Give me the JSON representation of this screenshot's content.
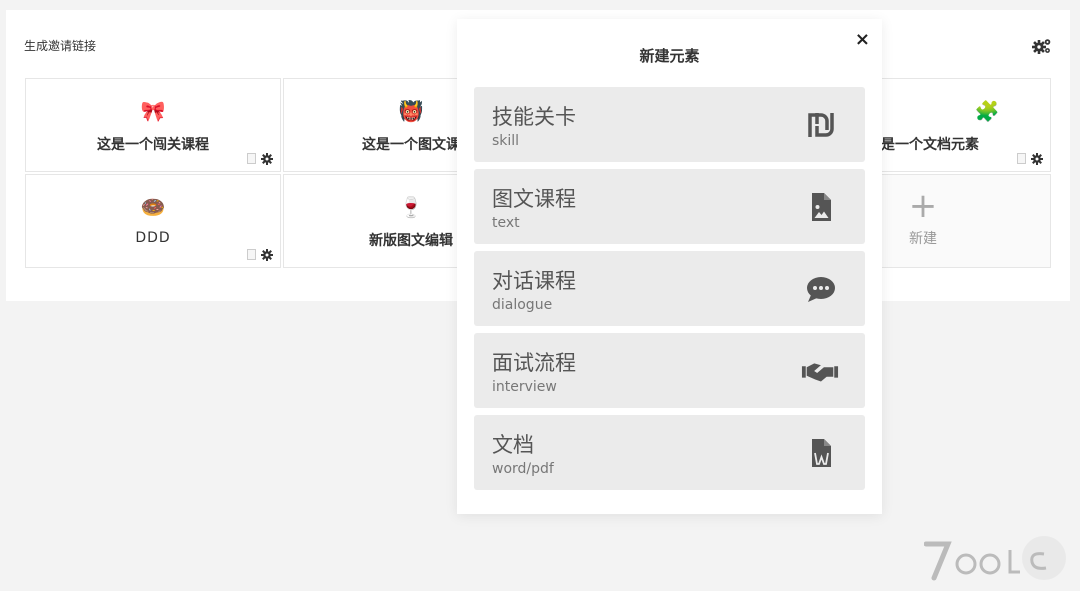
{
  "panel": {
    "title": "生成邀请链接",
    "settings_icon": "gears-icon"
  },
  "cards": [
    {
      "emoji": "🎀",
      "label": "这是一个闯关课程"
    },
    {
      "emoji": "👹",
      "label": "这是一个图文课"
    },
    {
      "emoji": "🧩",
      "label": "是一个文档元素"
    },
    {
      "emoji": "🍩",
      "label": "DDD"
    },
    {
      "emoji": "🍷",
      "label": "新版图文编辑"
    }
  ],
  "new_card": {
    "label": "新建"
  },
  "modal": {
    "title": "新建元素",
    "close": "×",
    "options": [
      {
        "title": "技能关卡",
        "sub": "skill",
        "icon": "shekel-icon"
      },
      {
        "title": "图文课程",
        "sub": "text",
        "icon": "file-image-icon"
      },
      {
        "title": "对话课程",
        "sub": "dialogue",
        "icon": "comment-dots-icon"
      },
      {
        "title": "面试流程",
        "sub": "interview",
        "icon": "handshake-icon"
      },
      {
        "title": "文档",
        "sub": "word/pdf",
        "icon": "file-word-icon"
      }
    ]
  },
  "colors": {
    "background": "#f3f3f3",
    "panel": "#ffffff",
    "option": "#ebebeb"
  }
}
